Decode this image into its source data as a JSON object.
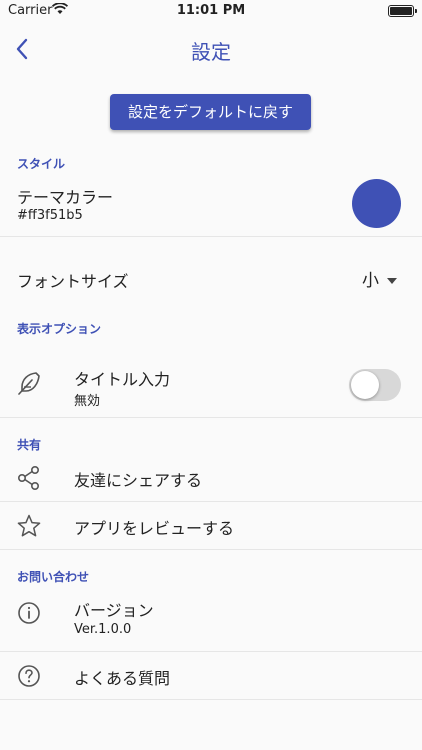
{
  "status_bar": {
    "carrier": "Carrier",
    "time": "11:01 PM"
  },
  "nav": {
    "title": "設定"
  },
  "reset_button": "設定をデフォルトに戻す",
  "sections": {
    "style": {
      "header": "スタイル",
      "theme_color_label": "テーマカラー",
      "theme_color_value": "#ff3f51b5",
      "theme_color_swatch": "#3f51b5",
      "font_size_label": "フォントサイズ",
      "font_size_value": "小"
    },
    "display": {
      "header": "表示オプション",
      "title_input_label": "タイトル入力",
      "title_input_status": "無効",
      "toggle_on": false
    },
    "share": {
      "header": "共有",
      "share_friends": "友達にシェアする",
      "review_app": "アプリをレビューする"
    },
    "contact": {
      "header": "お問い合わせ",
      "version_label": "バージョン",
      "version_value": "Ver.1.0.0",
      "faq": "よくある質問"
    }
  },
  "accent_color": "#3f51b5"
}
